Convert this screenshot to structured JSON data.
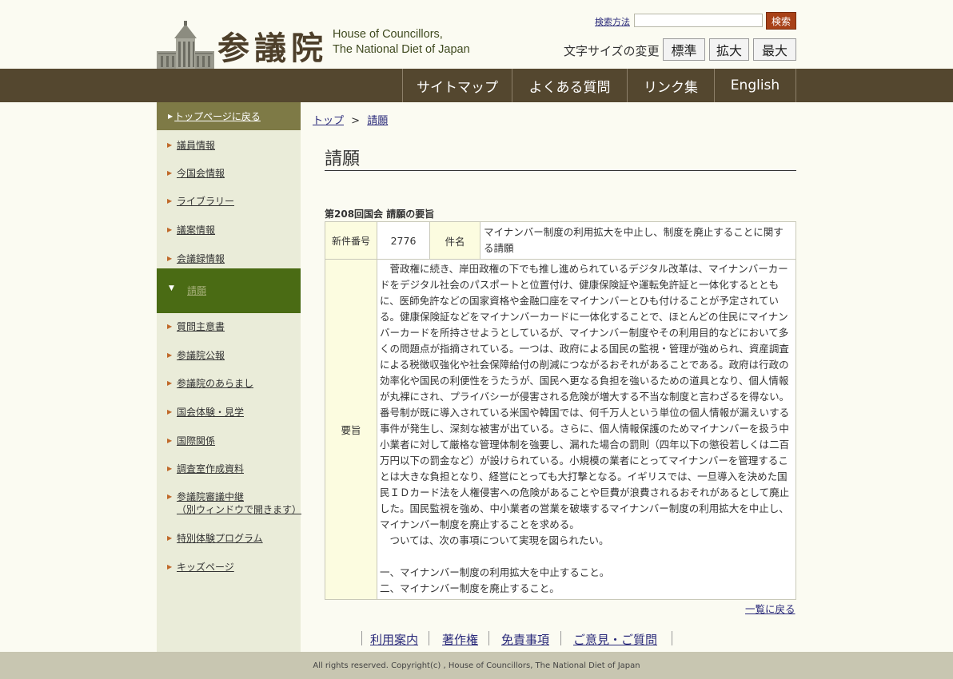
{
  "header": {
    "logo_kanji": "参議院",
    "logo_en_line1": "House of Councillors,",
    "logo_en_line2": "The National Diet of Japan",
    "search_help_label": "検索方法",
    "search_placeholder": "",
    "search_button_label": "検索",
    "font_size_label": "文字サイズの変更",
    "font_size_buttons": [
      "標準",
      "拡大",
      "最大"
    ]
  },
  "nav": {
    "items": [
      "サイトマップ",
      "よくある質問",
      "リンク集",
      "English"
    ]
  },
  "sidebar": {
    "top_label": "トップページに戻る",
    "items": [
      "議員情報",
      "今国会情報",
      "ライブラリー",
      "議案情報",
      "会議録情報",
      "請願",
      "質問主意書",
      "参議院公報",
      "参議院のあらまし",
      "国会体験・見学",
      "国際関係",
      "調査室作成資料",
      "参議院審議中継",
      "（別ウィンドウで開きます）",
      "特別体験プログラム",
      "キッズページ"
    ]
  },
  "breadcrumb": {
    "home": "トップ",
    "separator": ">",
    "current": "請願"
  },
  "page_title": "請願",
  "section_title": "第208回国会 請願の要旨",
  "petition": {
    "number_label": "新件番号",
    "number_value": "2776",
    "subject_label": "件名",
    "subject_value": "マイナンバー制度の利用拡大を中止し、制度を廃止することに関する請願",
    "summary_label": "要旨",
    "summary_paragraph1": "　菅政権に続き、岸田政権の下でも推し進められているデジタル改革は、マイナンバーカードをデジタル社会のパスポートと位置付け、健康保険証や運転免許証と一体化するとともに、医師免許などの国家資格や金融口座をマイナンバーとひも付けることが予定されている。健康保険証などをマイナンバーカードに一体化することで、ほとんどの住民にマイナンバーカードを所持させようとしているが、マイナンバー制度やその利用目的などにおいて多くの問題点が指摘されている。一つは、政府による国民の監視・管理が強められ、資産調査による税徴収強化や社会保障給付の削減につながるおそれがあることである。政府は行政の効率化や国民の利便性をうたうが、国民へ更なる負担を強いるための道具となり、個人情報が丸裸にされ、プライバシーが侵害される危険が増大する不当な制度と言わざるを得ない。番号制が既に導入されている米国や韓国では、何千万人という単位の個人情報が漏えいする事件が発生し、深刻な被害が出ている。さらに、個人情報保護のためマイナンバーを扱う中小業者に対して厳格な管理体制を強要し、漏れた場合の罰則（四年以下の懲役若しくは二百万円以下の罰金など）が設けられている。小規模の業者にとってマイナンバーを管理することは大きな負担となり、経営にとっても大打撃となる。イギリスでは、一旦導入を決めた国民ＩＤカード法を人権侵害への危険があることや巨費が浪費されるおそれがあるとして廃止した。国民監視を強め、中小業者の営業を破壊するマイナンバー制度の利用拡大を中止し、マイナンバー制度を廃止することを求める。",
    "summary_paragraph2": "　ついては、次の事項について実現を図られたい。",
    "summary_item1": "一、マイナンバー制度の利用拡大を中止すること。",
    "summary_item2": "二、マイナンバー制度を廃止すること。"
  },
  "back_link": "一覧に戻る",
  "footer": {
    "links": [
      "利用案内",
      "著作権",
      "免責事項",
      "ご意見・ご質問"
    ],
    "copyright": "All rights reserved. Copyright(c) , House of Councillors, The National Diet of Japan"
  },
  "colors": {
    "nav_bg": "#54472f",
    "sidebar_bg": "#eaecd9",
    "sidebar_active": "#4a6b14",
    "sidebar_top": "#7e7a46",
    "search_button": "#a84118",
    "table_header_bg": "#fcfce0"
  }
}
